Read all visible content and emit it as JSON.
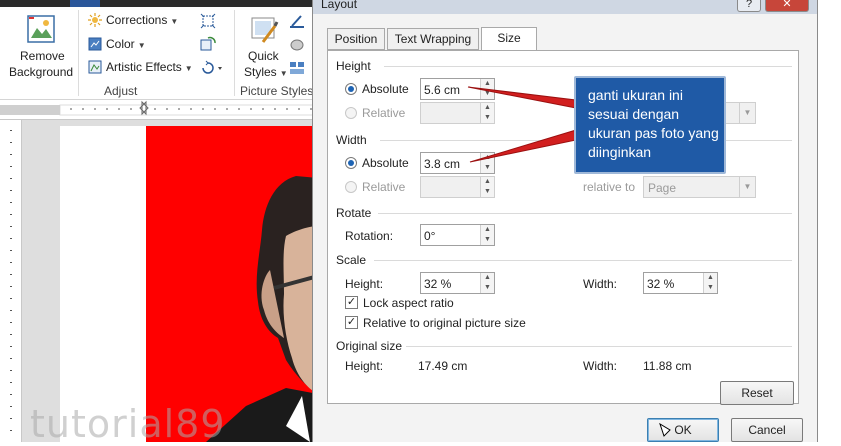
{
  "ribbon": {
    "remove_background": {
      "line1": "Remove",
      "line2": "Background"
    },
    "corrections": "Corrections",
    "color": "Color",
    "artistic_effects": "Artistic Effects",
    "adjust_label": "Adjust",
    "quick_styles": {
      "line1": "Quick",
      "line2": "Styles"
    },
    "picture_styles_label": "Picture Styles"
  },
  "dialog": {
    "title": "Layout",
    "tabs": [
      "Position",
      "Text Wrapping",
      "Size"
    ],
    "active_tab": "Size",
    "height": {
      "section": "Height",
      "absolute_label": "Absolute",
      "absolute_value": "5.6 cm",
      "relative_label": "Relative",
      "relative_to_value": ""
    },
    "width": {
      "section": "Width",
      "absolute_label": "Absolute",
      "absolute_value": "3.8 cm",
      "relative_label": "Relative",
      "relative_to_label": "relative to",
      "relative_to_value": "Page"
    },
    "rotate": {
      "section": "Rotate",
      "rotation_label": "Rotation:",
      "rotation_value": "0°"
    },
    "scale": {
      "section": "Scale",
      "height_label": "Height:",
      "height_value": "32 %",
      "width_label": "Width:",
      "width_value": "32 %",
      "lock_aspect_ratio": "Lock aspect ratio",
      "relative_original": "Relative to original picture size"
    },
    "original_size": {
      "section": "Original size",
      "height_label": "Height:",
      "height_value": "17.49 cm",
      "width_label": "Width:",
      "width_value": "11.88 cm"
    },
    "reset_button": "Reset",
    "ok_button": "OK",
    "cancel_button": "Cancel"
  },
  "callout": {
    "text": "ganti ukuran ini sesuai dengan ukuran pas foto yang diinginkan"
  },
  "watermark": {
    "text": "tutorial89"
  },
  "colors": {
    "callout_bg": "#1f5aa6",
    "photo_bg": "#ff0000",
    "arrow": "#d21f1f"
  }
}
